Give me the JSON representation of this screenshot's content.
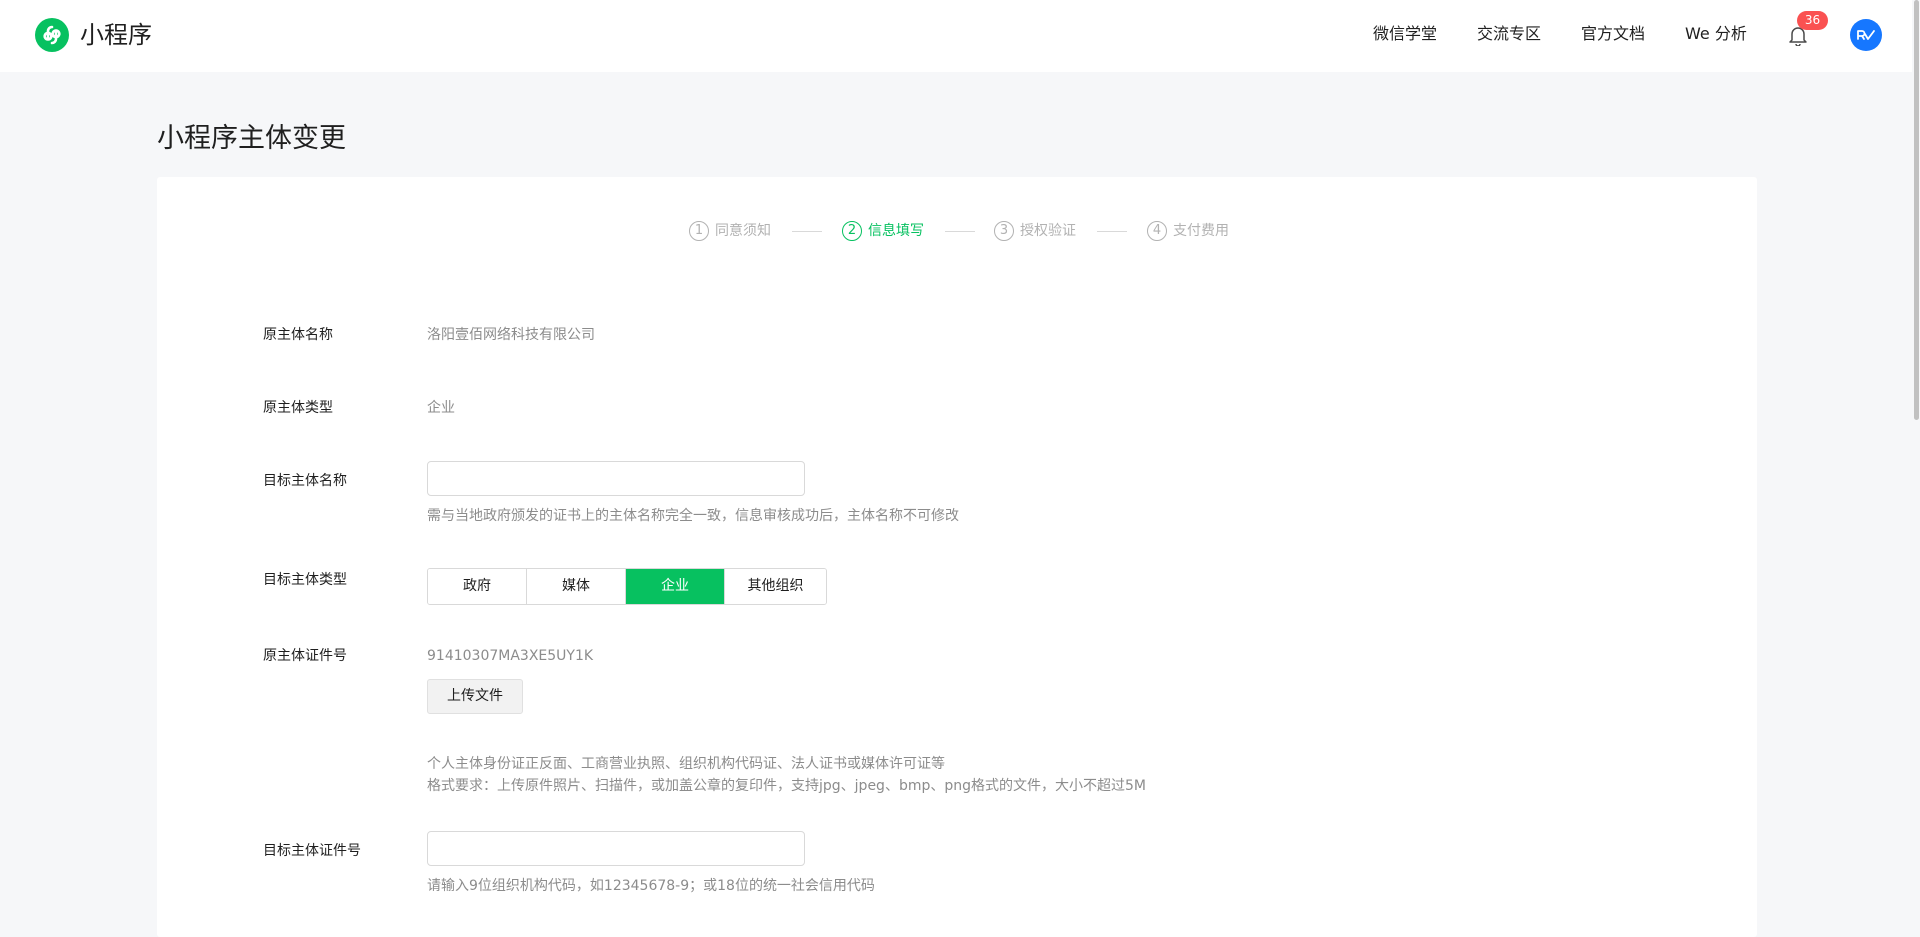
{
  "header": {
    "brand": "小程序",
    "nav": [
      "微信学堂",
      "交流专区",
      "官方文档",
      "We 分析"
    ],
    "notification_count": "36"
  },
  "page": {
    "title": "小程序主体变更"
  },
  "steps": [
    {
      "num": "1",
      "label": "同意须知",
      "active": false
    },
    {
      "num": "2",
      "label": "信息填写",
      "active": true
    },
    {
      "num": "3",
      "label": "授权验证",
      "active": false
    },
    {
      "num": "4",
      "label": "支付费用",
      "active": false
    }
  ],
  "form": {
    "original_name": {
      "label": "原主体名称",
      "value": "洛阳壹佰网络科技有限公司"
    },
    "original_type": {
      "label": "原主体类型",
      "value": "企业"
    },
    "target_name": {
      "label": "目标主体名称",
      "value": "",
      "placeholder": "",
      "tip": "需与当地政府颁发的证书上的主体名称完全一致，信息审核成功后，主体名称不可修改"
    },
    "target_type": {
      "label": "目标主体类型",
      "options": [
        "政府",
        "媒体",
        "企业",
        "其他组织"
      ],
      "selected": "企业"
    },
    "original_cert": {
      "label": "原主体证件号",
      "value": "91410307MA3XE5UY1K",
      "upload_label": "上传文件",
      "tip1": "个人主体身份证正反面、工商营业执照、组织机构代码证、法人证书或媒体许可证等",
      "tip2": "格式要求：上传原件照片、扫描件，或加盖公章的复印件，支持jpg、jpeg、bmp、png格式的文件，大小不超过5M"
    },
    "target_cert": {
      "label": "目标主体证件号",
      "value": "",
      "placeholder": "",
      "tip": "请输入9位组织机构代码，如12345678-9；或18位的统一社会信用代码"
    }
  },
  "icons": {
    "logo": "miniprogram-logo-icon",
    "bell": "bell-icon",
    "avatar": "avatar"
  },
  "colors": {
    "accent": "#07c160",
    "badge": "#fa5151",
    "avatar": "#1677ff"
  }
}
